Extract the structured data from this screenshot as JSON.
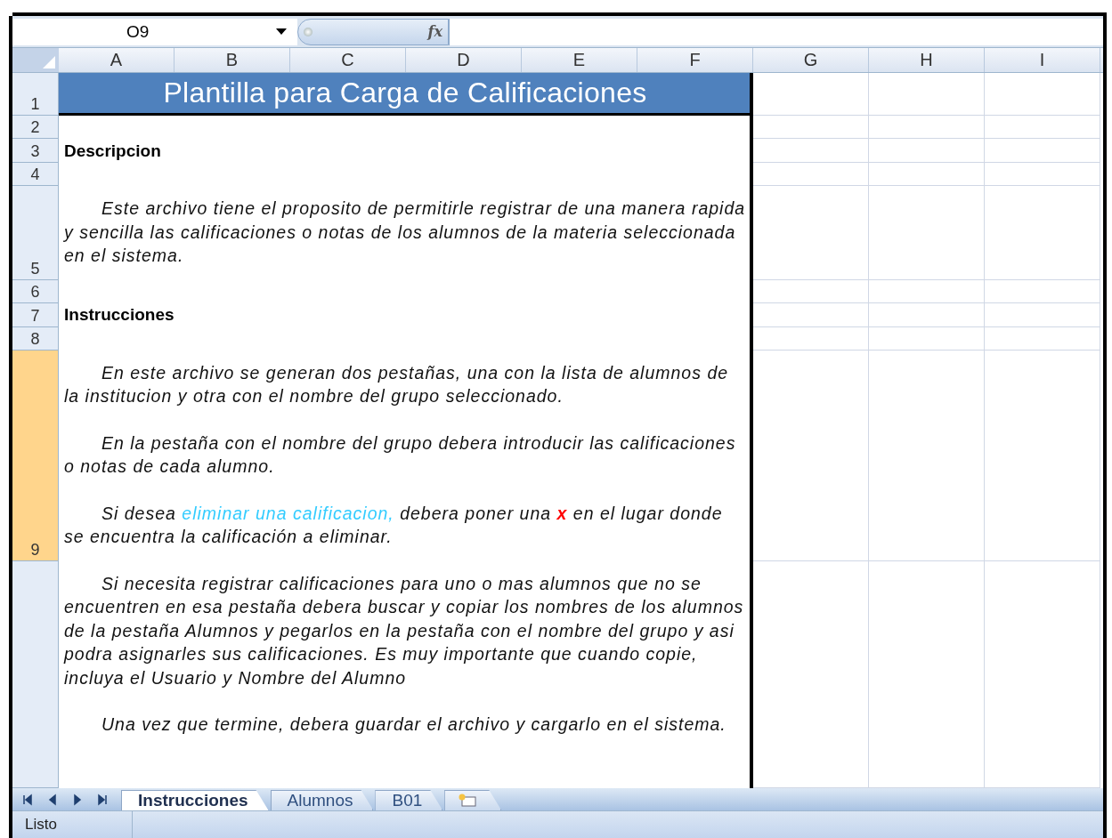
{
  "formula_bar": {
    "name_box": "O9",
    "function_button": "fx"
  },
  "columns": [
    {
      "label": "A",
      "selected": false
    },
    {
      "label": "B",
      "selected": false
    },
    {
      "label": "C",
      "selected": false
    },
    {
      "label": "D",
      "selected": false
    },
    {
      "label": "E",
      "selected": false
    },
    {
      "label": "F",
      "selected": false
    },
    {
      "label": "G",
      "selected": false
    },
    {
      "label": "H",
      "selected": false
    },
    {
      "label": "I",
      "selected": false
    }
  ],
  "rows": [
    {
      "number": "1",
      "selected": false,
      "kind": "title",
      "text": "Plantilla para Carga de Calificaciones"
    },
    {
      "number": "2",
      "selected": false,
      "kind": "blank"
    },
    {
      "number": "3",
      "selected": false,
      "kind": "heading",
      "text": "Descripcion"
    },
    {
      "number": "4",
      "selected": false,
      "kind": "blank"
    },
    {
      "number": "5",
      "selected": false,
      "kind": "body",
      "paragraphs": [
        [
          {
            "text": "Este archivo tiene el proposito de permitirle registrar de una manera rapida y sencilla las calificaciones o notas de los alumnos de la materia seleccionada en el sistema.",
            "kind": "text"
          }
        ]
      ]
    },
    {
      "number": "6",
      "selected": false,
      "kind": "blank"
    },
    {
      "number": "7",
      "selected": false,
      "kind": "heading",
      "text": "Instrucciones"
    },
    {
      "number": "8",
      "selected": false,
      "kind": "blank"
    },
    {
      "number": "9",
      "selected": true,
      "kind": "body",
      "paragraphs": [
        [
          {
            "text": "En este archivo se generan dos pestañas, una con la lista de alumnos de la institucion y otra con el nombre del grupo seleccionado.",
            "kind": "text"
          }
        ],
        [
          {
            "text": "En la pestaña con el nombre del grupo debera introducir las calificaciones o notas de cada alumno.",
            "kind": "text"
          }
        ],
        [
          {
            "text": "Si desea ",
            "kind": "text"
          },
          {
            "text": "eliminar una calificacion,",
            "kind": "link"
          },
          {
            "text": " debera poner una ",
            "kind": "text"
          },
          {
            "text": "x",
            "kind": "mark"
          },
          {
            "text": " en el lugar donde se encuentra la calificación a eliminar.",
            "kind": "text"
          }
        ]
      ]
    },
    {
      "selected": false,
      "kind": "body",
      "paragraphs": [
        [
          {
            "text": "Si necesita registrar calificaciones para uno o mas alumnos que no se encuentren en esa pestaña debera buscar y copiar los nombres de los alumnos de la pestaña Alumnos y pegarlos en la pestaña con el nombre del grupo y asi podra asignarles sus calificaciones. Es muy importante que cuando copie, incluya el Usuario y Nombre del Alumno",
            "kind": "text"
          }
        ],
        [
          {
            "text": "Una vez que termine, debera guardar el archivo y cargarlo en el sistema.",
            "kind": "text"
          }
        ]
      ]
    }
  ],
  "sheet_tabs": [
    {
      "label": "Instrucciones",
      "selected": true
    },
    {
      "label": "Alumnos",
      "selected": false
    },
    {
      "label": "B01",
      "selected": false
    }
  ],
  "status_bar": {
    "text": "Listo"
  }
}
